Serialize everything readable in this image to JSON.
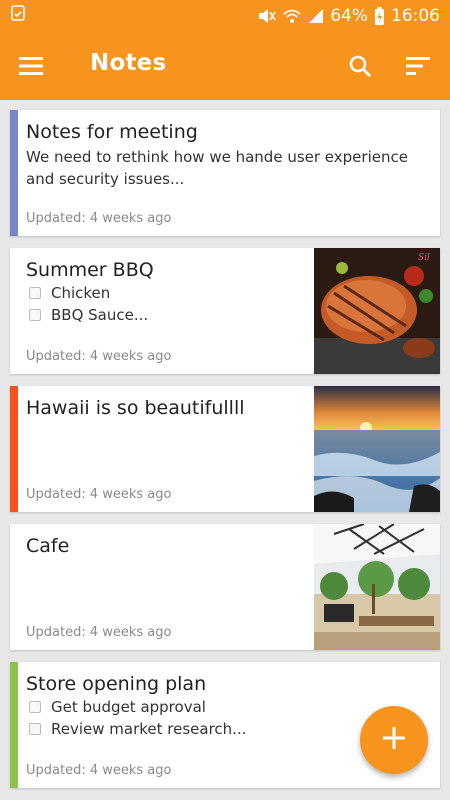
{
  "status_bar": {
    "battery": "64%",
    "time": "16:06"
  },
  "app_bar": {
    "title": "Notes",
    "menu_icon": "hamburger-menu-icon",
    "search_icon": "search-icon",
    "sort_icon": "sort-icon"
  },
  "notes": [
    {
      "title": "Notes for meeting",
      "text": "We need to rethink how we hande user experience and security issues...",
      "updated": "Updated: 4 weeks ago",
      "accent": "#7986cb"
    },
    {
      "title": "Summer BBQ",
      "items": [
        "Chicken",
        "BBQ Sauce..."
      ],
      "updated": "Updated: 4 weeks ago",
      "image": "grilled-meat-photo"
    },
    {
      "title": "Hawaii is so beautifullll",
      "updated": "Updated: 4 weeks ago",
      "accent": "#f4511e",
      "image": "ocean-sunset-photo"
    },
    {
      "title": "Cafe",
      "updated": "Updated: 4 weeks ago",
      "image": "cafe-interior-photo"
    },
    {
      "title": "Store opening plan",
      "items": [
        "Get budget approval",
        "Review market research..."
      ],
      "updated": "Updated: 4 weeks ago",
      "accent": "#8bc34a"
    }
  ],
  "fab": {
    "icon": "plus-icon"
  },
  "colors": {
    "primary": "#f7941d",
    "background": "#e8e8e8"
  }
}
